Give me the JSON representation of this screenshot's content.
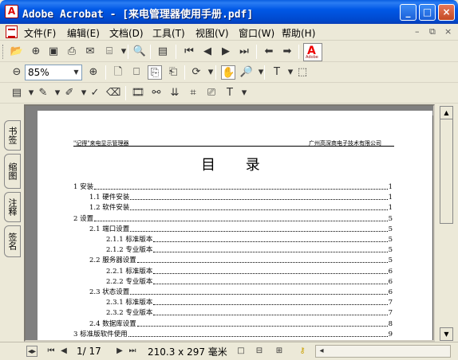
{
  "window": {
    "title": "Adobe Acrobat - [来电管理器使用手册.pdf]",
    "minimize": "_",
    "maximize": "□",
    "close": "×"
  },
  "menu": [
    "文件(F)",
    "编辑(E)",
    "文档(D)",
    "工具(T)",
    "视图(V)",
    "窗口(W)",
    "帮助(H)"
  ],
  "mdi_controls": [
    "–",
    "⧉",
    "×"
  ],
  "toolbar": {
    "zoom_value": "85%",
    "adobe_logo_text": "Adobe"
  },
  "side_tabs": [
    "书签",
    "缩图",
    "注释",
    "签名"
  ],
  "page": {
    "header_left": "\"记得\"来电显示管理器",
    "header_right": "广州高深商电子技术有限公司",
    "toc_title": "目 录",
    "toc": [
      {
        "label": "1 安装",
        "page": "1",
        "level": 0
      },
      {
        "label": "1.1  硬件安装",
        "page": "1",
        "level": 1
      },
      {
        "label": "1.2  软件安装",
        "page": "1",
        "level": 1
      },
      {
        "label": "2  设置",
        "page": "5",
        "level": 0
      },
      {
        "label": "2.1  端口设置",
        "page": "5",
        "level": 1
      },
      {
        "label": "2.1.1  标准版本",
        "page": "5",
        "level": 2
      },
      {
        "label": "2.1.2  专业版本",
        "page": "5",
        "level": 2
      },
      {
        "label": "2.2  服务器设置",
        "page": "5",
        "level": 1
      },
      {
        "label": "2.2.1  标准版本",
        "page": "6",
        "level": 2
      },
      {
        "label": "2.2.2  专业版本",
        "page": "6",
        "level": 2
      },
      {
        "label": "2.3  状态设置",
        "page": "6",
        "level": 1
      },
      {
        "label": "2.3.1  标准版本",
        "page": "7",
        "level": 2
      },
      {
        "label": "2.3.2  专业版本",
        "page": "7",
        "level": 2
      },
      {
        "label": "2.4  数据库设置",
        "page": "8",
        "level": 1
      },
      {
        "label": "3  标准版软件使用",
        "page": "9",
        "level": 0
      }
    ]
  },
  "status": {
    "page_indicator": "1/ 17",
    "page_size": "210.3 x 297 毫米"
  }
}
